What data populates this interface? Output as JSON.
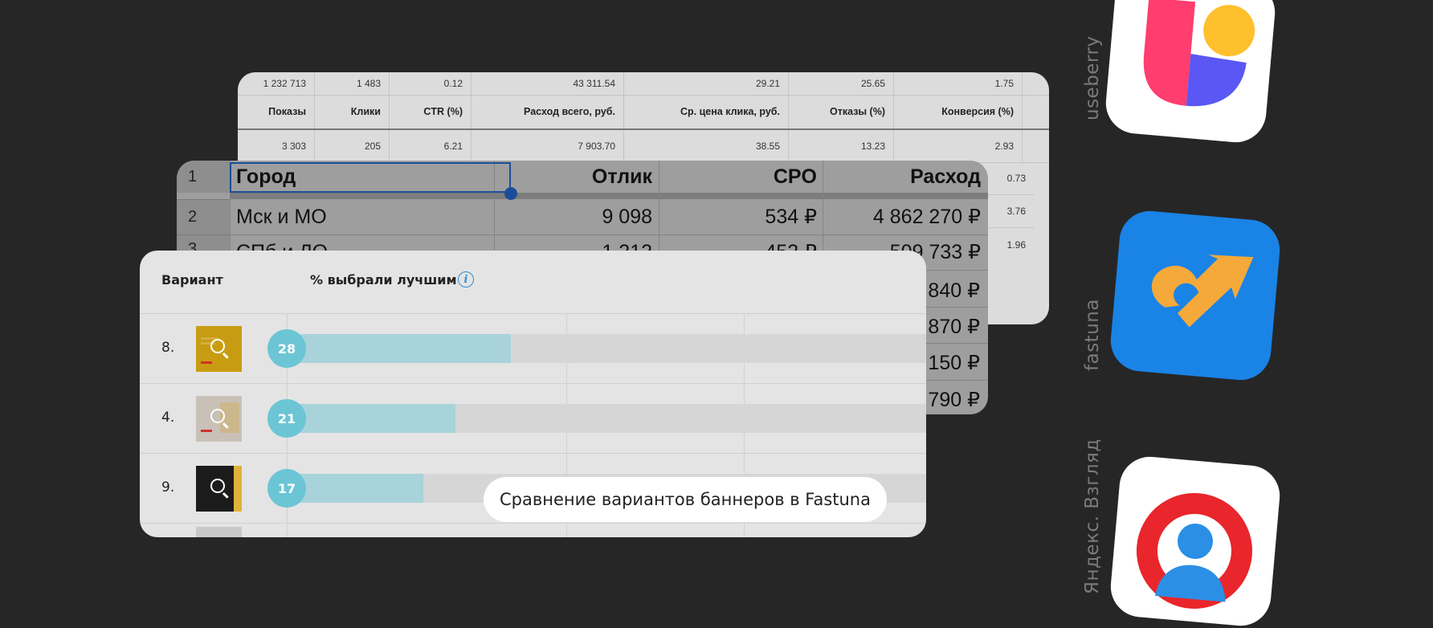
{
  "yandex_table": {
    "top_row": [
      "1 232 713",
      "1 483",
      "0.12",
      "43 311.54",
      "29.21",
      "25.65",
      "1.75"
    ],
    "headers": [
      "Показы",
      "Клики",
      "CTR (%)",
      "Расход всего, руб.",
      "Ср. цена клика, руб.",
      "Отказы (%)",
      "Конверсия (%)"
    ],
    "row_1": [
      "3 303",
      "205",
      "6.21",
      "7 903.70",
      "38.55",
      "13.23",
      "2.93"
    ],
    "conversion_rest": [
      "0.73",
      "3.76",
      "1.96"
    ]
  },
  "spreadsheet": {
    "row_numbers": [
      "1",
      "2",
      "3"
    ],
    "headers": [
      "Город",
      "Отлик",
      "CPO",
      "Расход"
    ],
    "rows": [
      {
        "city": "Мск и МО",
        "response": "9 098",
        "cpo": "534 ₽",
        "spend": "4 862 270 ₽"
      },
      {
        "city": "СПб и ЛО",
        "response": "1 212",
        "cpo": "452 ₽",
        "spend": "509 733 ₽"
      }
    ],
    "spend_partial": [
      "840 ₽",
      "870 ₽",
      "150 ₽",
      "790 ₽"
    ]
  },
  "fastuna": {
    "col_variant": "Вариант",
    "col_percent": "% выбрали лучшим",
    "info_glyph": "i",
    "rows": [
      {
        "num": "8.",
        "percent": 28,
        "label": "28",
        "thumb_color": "#c89c12"
      },
      {
        "num": "4.",
        "percent": 21,
        "label": "21",
        "thumb_color": "#c9c1b8"
      },
      {
        "num": "9.",
        "percent": 17,
        "label": "17",
        "thumb_color": "#1b1b1b"
      }
    ],
    "caption": "Сравнение вариантов баннеров в Fastuna"
  },
  "apps": [
    {
      "name": "useberry",
      "icon": "useberry-icon"
    },
    {
      "name": "fastuna",
      "icon": "fastuna-icon"
    },
    {
      "name": "Яндекс. Взгляд",
      "icon": "yandex-vzglyad-icon"
    }
  ],
  "colors": {
    "background": "#262626",
    "fastuna_blue": "#1a83e6",
    "fastuna_orange": "#f4a93a",
    "bar_fill": "#a8d3da",
    "bubble": "#6cc5d5",
    "useberry_pink": "#ff3d6e",
    "useberry_yellow": "#ffc02e",
    "useberry_purple": "#5a57f5",
    "vzglyad_red": "#e8262b",
    "vzglyad_blue": "#2b8fe6"
  }
}
